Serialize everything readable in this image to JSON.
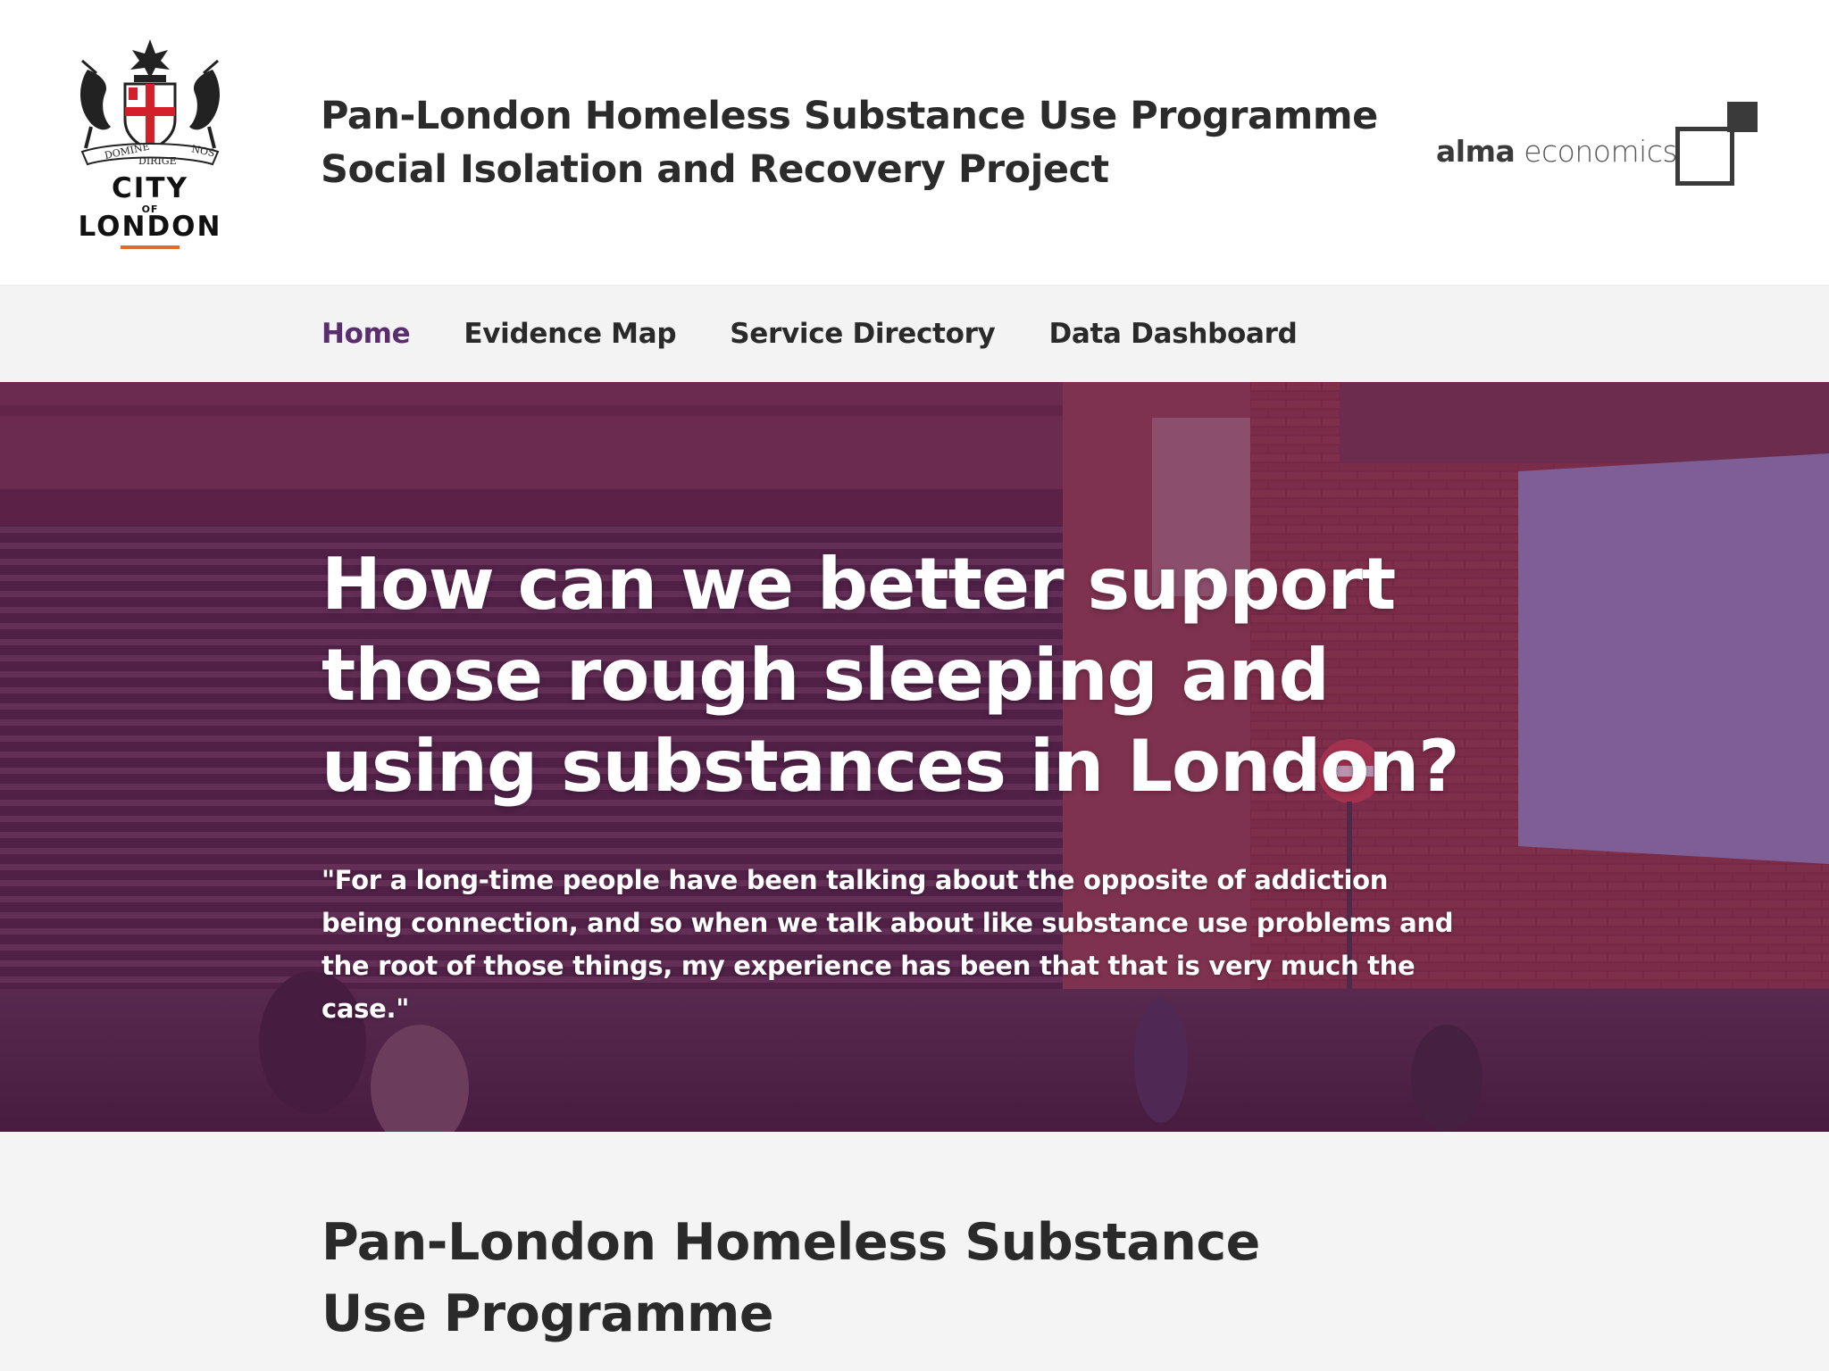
{
  "header": {
    "logo_left": {
      "icon": "city-of-london-crest",
      "motto_left": "DOMINE",
      "motto_center": "DIRIGE",
      "motto_right": "NOS",
      "line1": "CITY",
      "line2": "OF",
      "line3": "LONDON"
    },
    "title_line1": "Pan-London Homeless Substance Use Programme",
    "title_line2": "Social Isolation and Recovery Project",
    "logo_right": {
      "word_a": "alma",
      "word_b": "economics",
      "icon": "alma-economics-mark"
    }
  },
  "nav": {
    "items": [
      {
        "label": "Home",
        "active": true
      },
      {
        "label": "Evidence Map",
        "active": false
      },
      {
        "label": "Service Directory",
        "active": false
      },
      {
        "label": "Data Dashboard",
        "active": false
      }
    ]
  },
  "hero": {
    "title": "How can we better support those rough sleeping and using substances in London?",
    "quote": "\"For a long-time people have been talking about the opposite of addiction being connection, and so when we talk about like substance use problems and the root of those things, my experience has been that that is very much the case.\""
  },
  "section": {
    "title": "Pan-London Homeless Substance Use Programme"
  },
  "colors": {
    "accent": "#5a2d6e",
    "logo_underline": "#e06b2a",
    "hero_overlay": "#6e286e"
  }
}
